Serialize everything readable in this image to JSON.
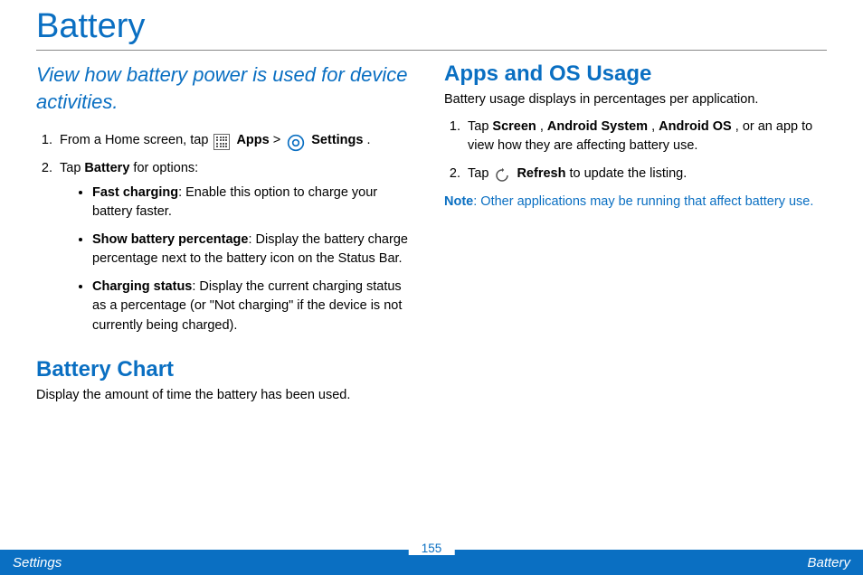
{
  "page": {
    "title": "Battery",
    "subtitle": "View how battery power is used for device activities.",
    "number": "155"
  },
  "footer": {
    "left": "Settings",
    "right": "Battery"
  },
  "left_col": {
    "step1": {
      "pre": "From a Home screen, tap ",
      "apps": "Apps",
      "gt": " > ",
      "settings": "Settings",
      "post": "."
    },
    "step2": {
      "pre": "Tap ",
      "battery": "Battery",
      "post": " for options:"
    },
    "bullets": [
      {
        "label": "Fast charging",
        "text": ": Enable this option to charge your battery faster."
      },
      {
        "label": "Show battery percentage",
        "text": ": Display the battery charge percentage next to the battery icon on the Status Bar."
      },
      {
        "label": "Charging status",
        "text": ": Display the current charging status as a percentage (or \"Not charging\" if the device is not currently being charged)."
      }
    ],
    "battery_chart": {
      "heading": "Battery Chart",
      "lead": "Display the amount of time the battery has been used."
    }
  },
  "right_col": {
    "apps_os": {
      "heading": "Apps and OS Usage",
      "lead": "Battery usage displays in percentages per application.",
      "step1": {
        "pre": "Tap ",
        "screen": "Screen",
        "sep1": ", ",
        "android_system": "Android System",
        "sep2": ", ",
        "android_os": "Android OS",
        "post": ", or an app to view how they are affecting battery use."
      },
      "step2": {
        "pre": "Tap ",
        "refresh": "Refresh",
        "post": " to update the listing."
      },
      "note_label": "Note",
      "note_text": ": Other applications may be running that affect battery use."
    }
  }
}
